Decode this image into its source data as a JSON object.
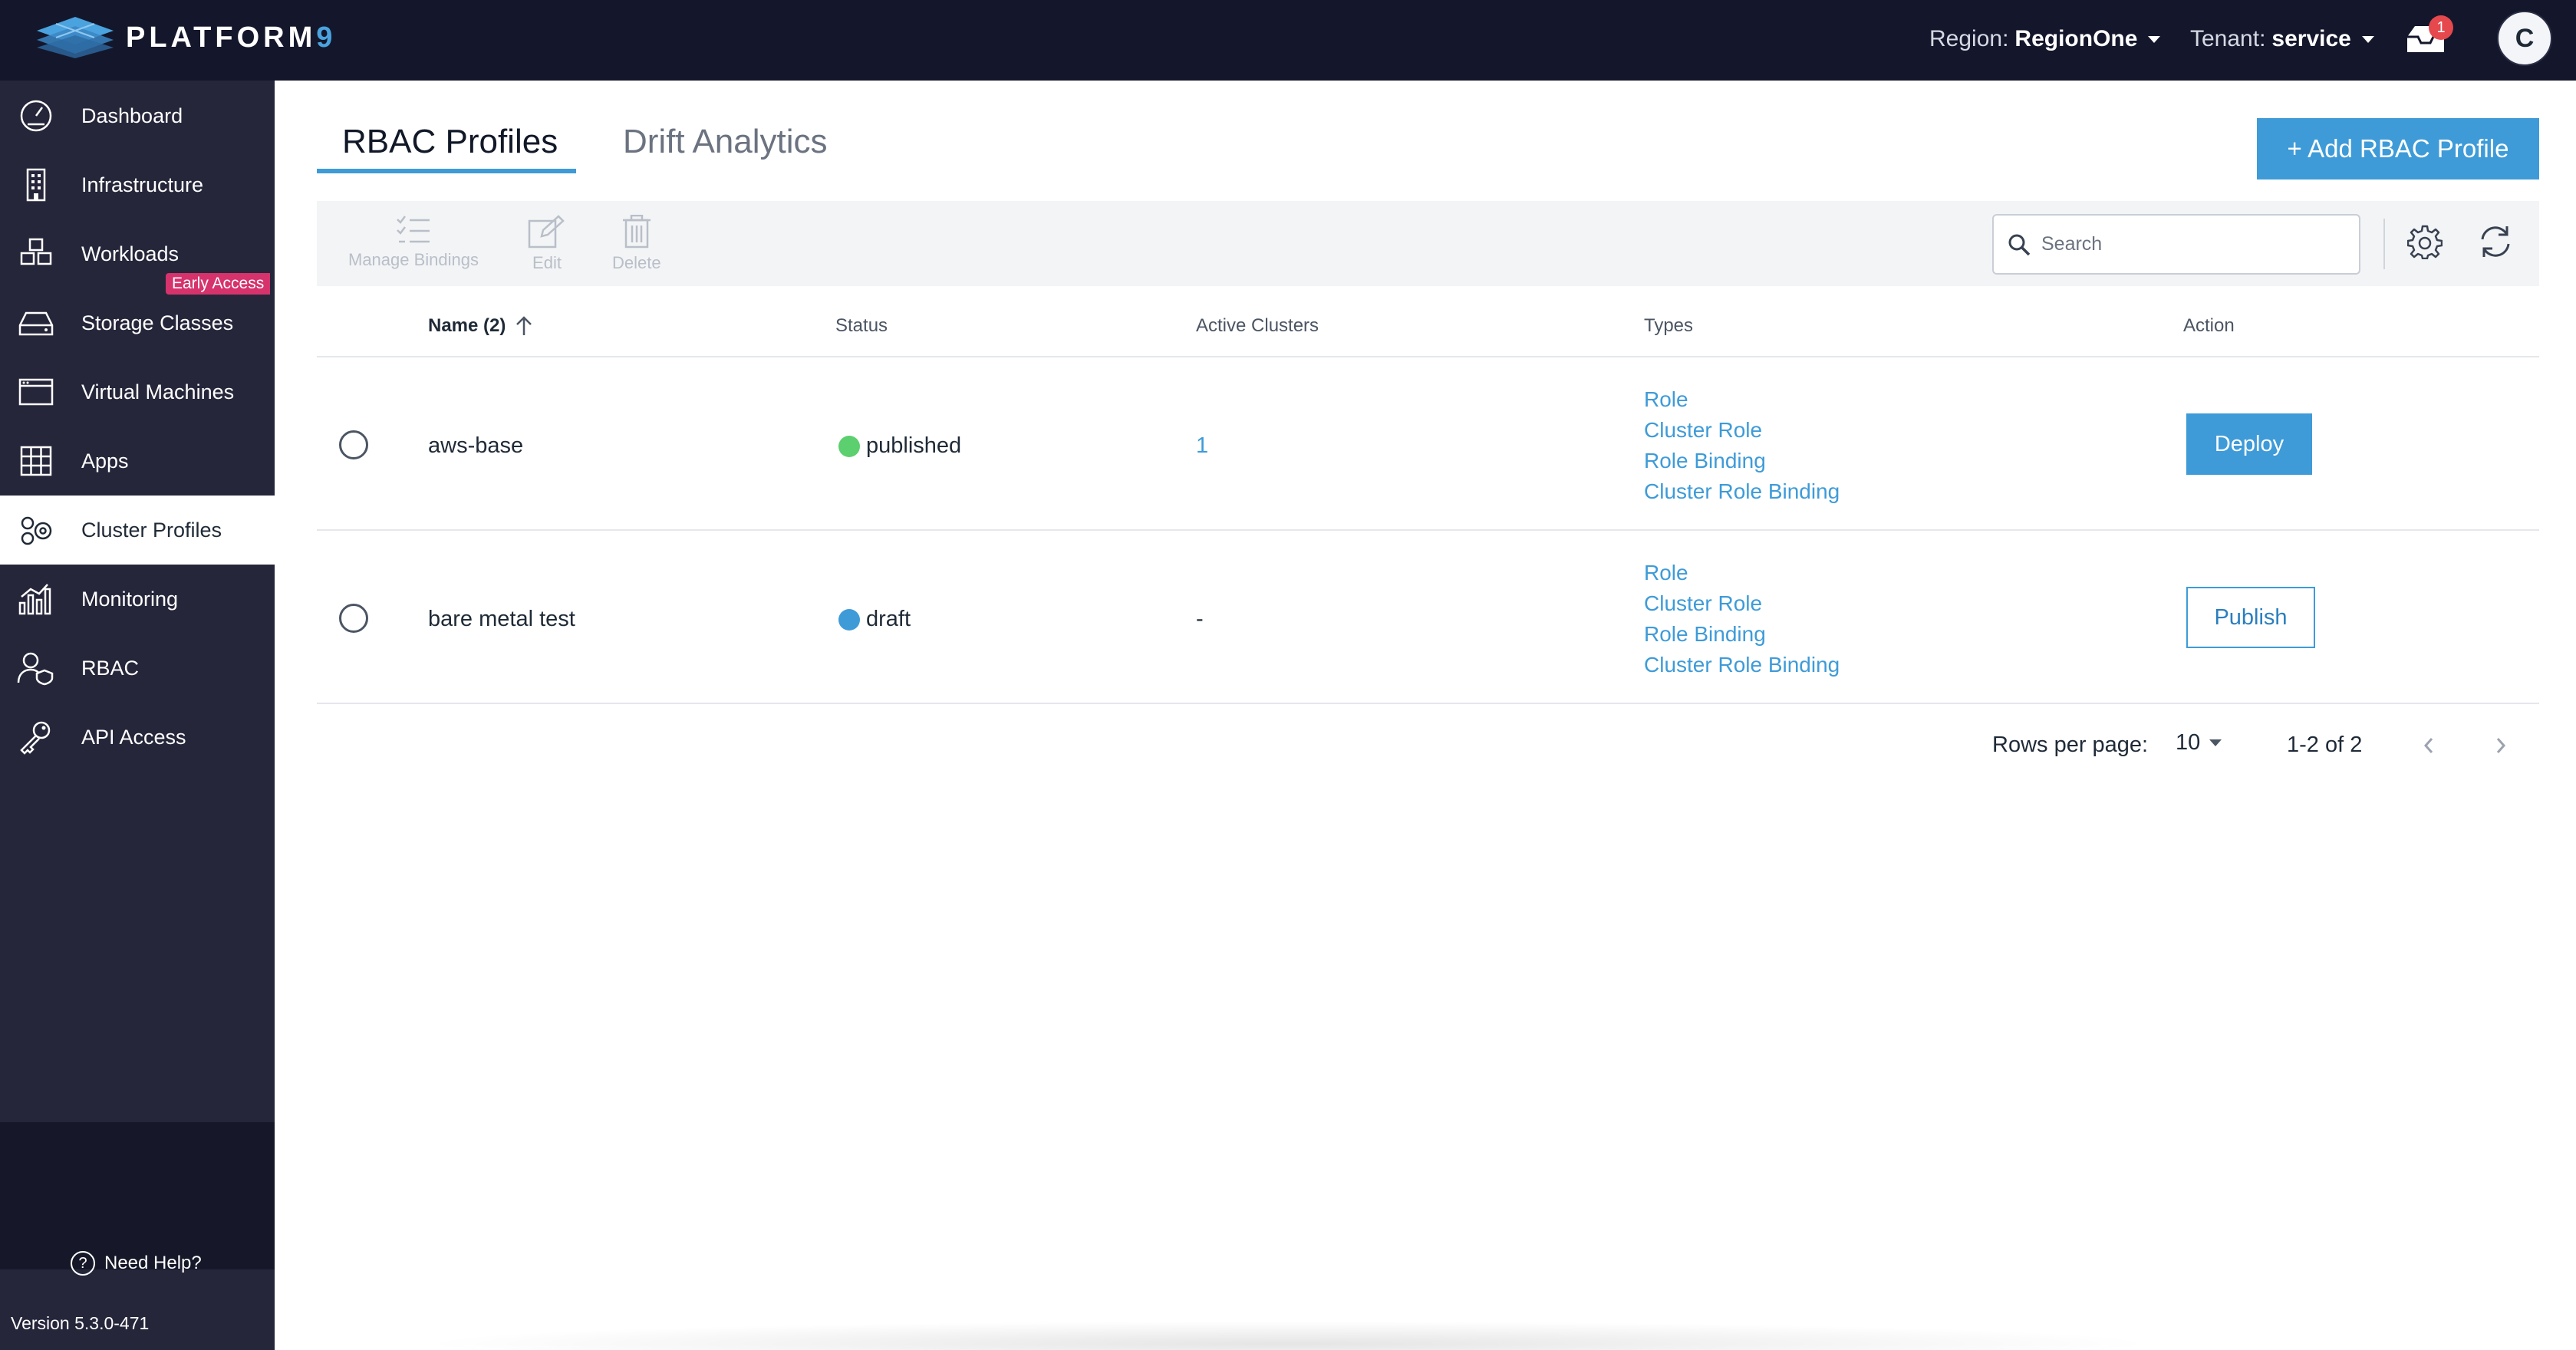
{
  "app": {
    "logo_text": "PLATFORM",
    "logo_nine": "9"
  },
  "header": {
    "region_label": "Region:",
    "region_value": "RegionOne",
    "tenant_label": "Tenant:",
    "tenant_value": "service",
    "notification_count": "1",
    "avatar_initial": "C"
  },
  "sidebar": {
    "items": [
      {
        "label": "Dashboard",
        "icon": "dashboard-gauge-icon"
      },
      {
        "label": "Infrastructure",
        "icon": "building-icon"
      },
      {
        "label": "Workloads",
        "icon": "cubes-icon"
      },
      {
        "label": "Storage Classes",
        "icon": "storage-drive-icon"
      },
      {
        "label": "Virtual Machines",
        "icon": "vm-window-icon",
        "badge": "Early Access"
      },
      {
        "label": "Apps",
        "icon": "grid-icon"
      },
      {
        "label": "Cluster Profiles",
        "icon": "cluster-gears-icon",
        "active": true
      },
      {
        "label": "Monitoring",
        "icon": "bar-chart-icon"
      },
      {
        "label": "RBAC",
        "icon": "user-shield-icon"
      },
      {
        "label": "API Access",
        "icon": "key-icon"
      }
    ],
    "help": "Need Help?",
    "version": "Version 5.3.0-471"
  },
  "tabs": [
    {
      "label": "RBAC Profiles",
      "active": true
    },
    {
      "label": "Drift Analytics",
      "active": false
    }
  ],
  "actions": {
    "add_button": "+ Add RBAC Profile"
  },
  "toolbar": {
    "manage_bindings": "Manage Bindings",
    "edit": "Edit",
    "delete": "Delete",
    "search_placeholder": "Search"
  },
  "table": {
    "columns": {
      "name": "Name (2)",
      "status": "Status",
      "active_clusters": "Active Clusters",
      "types": "Types",
      "action": "Action"
    },
    "rows": [
      {
        "name": "aws-base",
        "status": "published",
        "status_color": "#5ccf6f",
        "active_clusters": "1",
        "types": [
          "Role",
          "Cluster Role",
          "Role Binding",
          "Cluster Role Binding"
        ],
        "action": "Deploy"
      },
      {
        "name": "bare metal test",
        "status": "draft",
        "status_color": "#3e9bd8",
        "active_clusters": "-",
        "types": [
          "Role",
          "Cluster Role",
          "Role Binding",
          "Cluster Role Binding"
        ],
        "action": "Publish"
      }
    ]
  },
  "pagination": {
    "rows_per_page_label": "Rows per page:",
    "rows_per_page": "10",
    "range": "1-2 of 2"
  },
  "colors": {
    "accent": "#3e9bd8",
    "topbar": "#14172b",
    "sidebar": "#25263a",
    "badge": "#d6336c"
  }
}
